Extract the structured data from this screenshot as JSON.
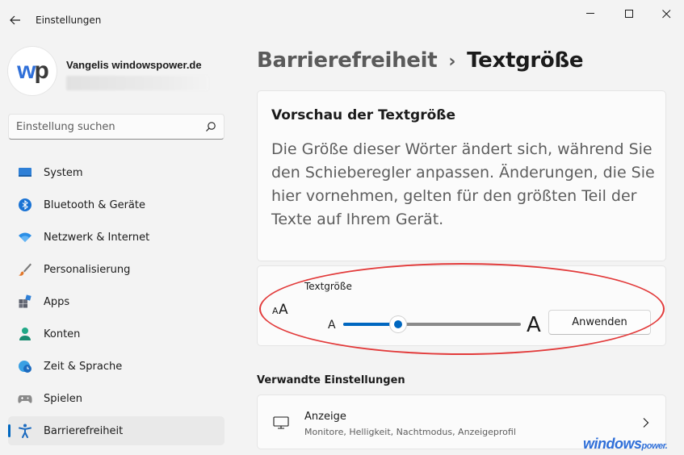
{
  "window": {
    "title": "Einstellungen",
    "controls": {
      "minimize": "minimize-icon",
      "maximize": "maximize-icon",
      "close": "close-icon"
    }
  },
  "profile": {
    "avatar_logo": "wp",
    "name": "Vangelis windowspower.de"
  },
  "search": {
    "placeholder": "Einstellung suchen"
  },
  "sidebar": {
    "items": [
      {
        "label": "System",
        "icon": "monitor-icon"
      },
      {
        "label": "Bluetooth & Geräte",
        "icon": "bluetooth-icon"
      },
      {
        "label": "Netzwerk & Internet",
        "icon": "wifi-icon"
      },
      {
        "label": "Personalisierung",
        "icon": "brush-icon"
      },
      {
        "label": "Apps",
        "icon": "apps-icon"
      },
      {
        "label": "Konten",
        "icon": "person-icon"
      },
      {
        "label": "Zeit & Sprache",
        "icon": "globe-clock-icon"
      },
      {
        "label": "Spielen",
        "icon": "gamepad-icon"
      },
      {
        "label": "Barrierefreiheit",
        "icon": "accessibility-icon",
        "active": true
      }
    ]
  },
  "header": {
    "parent": "Barrierefreiheit",
    "separator": "›",
    "current": "Textgröße"
  },
  "preview": {
    "title": "Vorschau der Textgröße",
    "text": "Die Größe dieser Wörter ändert sich, während Sie den Schieberegler anpassen. Änderungen, die Sie hier vornehmen, gelten für den größten Teil der Texte auf Ihrem Gerät."
  },
  "text_size": {
    "label": "Textgröße",
    "small_glyph": "A",
    "large_glyph": "A",
    "slider_fraction": 0.31,
    "apply_label": "Anwenden"
  },
  "related": {
    "heading": "Verwandte Einstellungen",
    "display": {
      "title": "Anzeige",
      "subtitle": "Monitore, Helligkeit, Nachtmodus, Anzeigeprofil"
    }
  },
  "watermark": {
    "main": "windows",
    "suffix": "power."
  },
  "colors": {
    "accent": "#0067c0",
    "highlight_ring": "#e23a3a",
    "brand_blue": "#2f6fd8"
  }
}
